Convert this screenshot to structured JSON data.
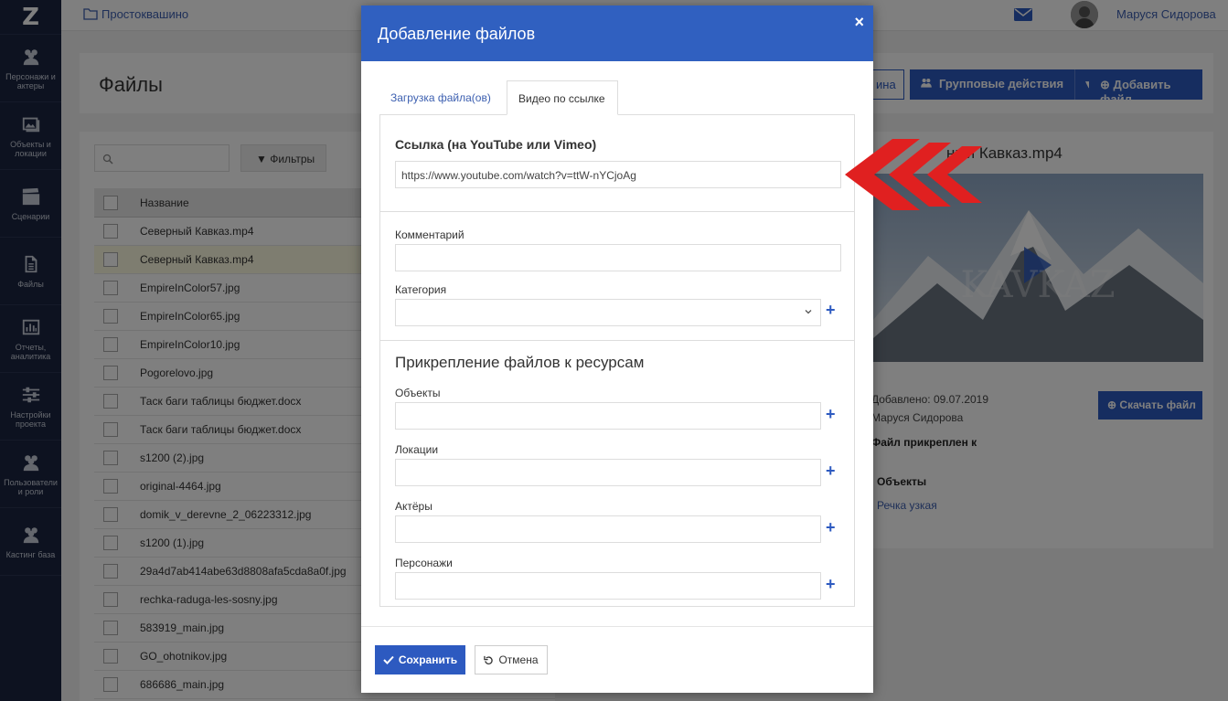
{
  "app": {
    "logo": "Z",
    "breadcrumb": "Простоквашино",
    "user_name": "Маруся Сидорова"
  },
  "sidebar": {
    "items": [
      {
        "label": "Персонажи и актеры",
        "icon": "users-icon"
      },
      {
        "label": "Объекты и локации",
        "icon": "image-icon"
      },
      {
        "label": "Сценарии",
        "icon": "clapperboard-icon"
      },
      {
        "label": "Файлы",
        "icon": "file-icon"
      },
      {
        "label": "Отчеты, аналитика",
        "icon": "bar-chart-icon"
      },
      {
        "label": "Настройки проекта",
        "icon": "sliders-icon"
      },
      {
        "label": "Пользователи и роли",
        "icon": "users-icon"
      },
      {
        "label": "Кастинг база",
        "icon": "users-icon"
      }
    ]
  },
  "page": {
    "title": "Файлы",
    "btn_partial": "ина",
    "btn_group_actions": "Групповые действия",
    "btn_add_file": "Добавить файл"
  },
  "files": {
    "filter_label": "Фильтры",
    "column_name": "Название",
    "rows": [
      "Северный Кавказ.mp4",
      "Северный Кавказ.mp4",
      "EmpireInColor57.jpg",
      "EmpireInColor65.jpg",
      "EmpireInColor10.jpg",
      "Pogorelovo.jpg",
      "Таск баги таблицы бюджет.docx",
      "Таск баги таблицы бюджет.docx",
      "s1200 (2).jpg",
      "original-4464.jpg",
      "domik_v_derevne_2_06223312.jpg",
      "s1200 (1).jpg",
      "29a4d7ab414abe63d8808afa5cda8a0f.jpg",
      "rechka-raduga-les-sosny.jpg",
      "583919_main.jpg",
      "GO_ohotnikov.jpg",
      "686686_main.jpg"
    ]
  },
  "preview": {
    "title": "ный Кавказ.mp4",
    "image_text": "KAVKAZ",
    "added": "Добавлено: 09.07.2019",
    "author": "Маруся Сидорова",
    "attached_to": "Файл прикреплен к",
    "objects_heading": "Объекты",
    "object_item": "Речка узкая",
    "download_label": "Скачать файл"
  },
  "modal": {
    "title": "Добавление файлов",
    "close": "×",
    "tab_upload": "Загрузка файла(ов)",
    "tab_video": "Видео по ссылке",
    "link_label": "Ссылка (на YouTube или Vimeo)",
    "link_value": "https://www.youtube.com/watch?v=ttW-nYCjoAg",
    "comment_label": "Комментарий",
    "category_label": "Категория",
    "attach_heading": "Прикрепление файлов к ресурсам",
    "objects_label": "Объекты",
    "locations_label": "Локации",
    "actors_label": "Актёры",
    "characters_label": "Персонажи",
    "plus": "+",
    "save_label": "Сохранить",
    "cancel_label": "Отмена"
  },
  "colors": {
    "primary": "#3060c0",
    "sidebar": "#1b2540",
    "annotation": "#e02020"
  }
}
